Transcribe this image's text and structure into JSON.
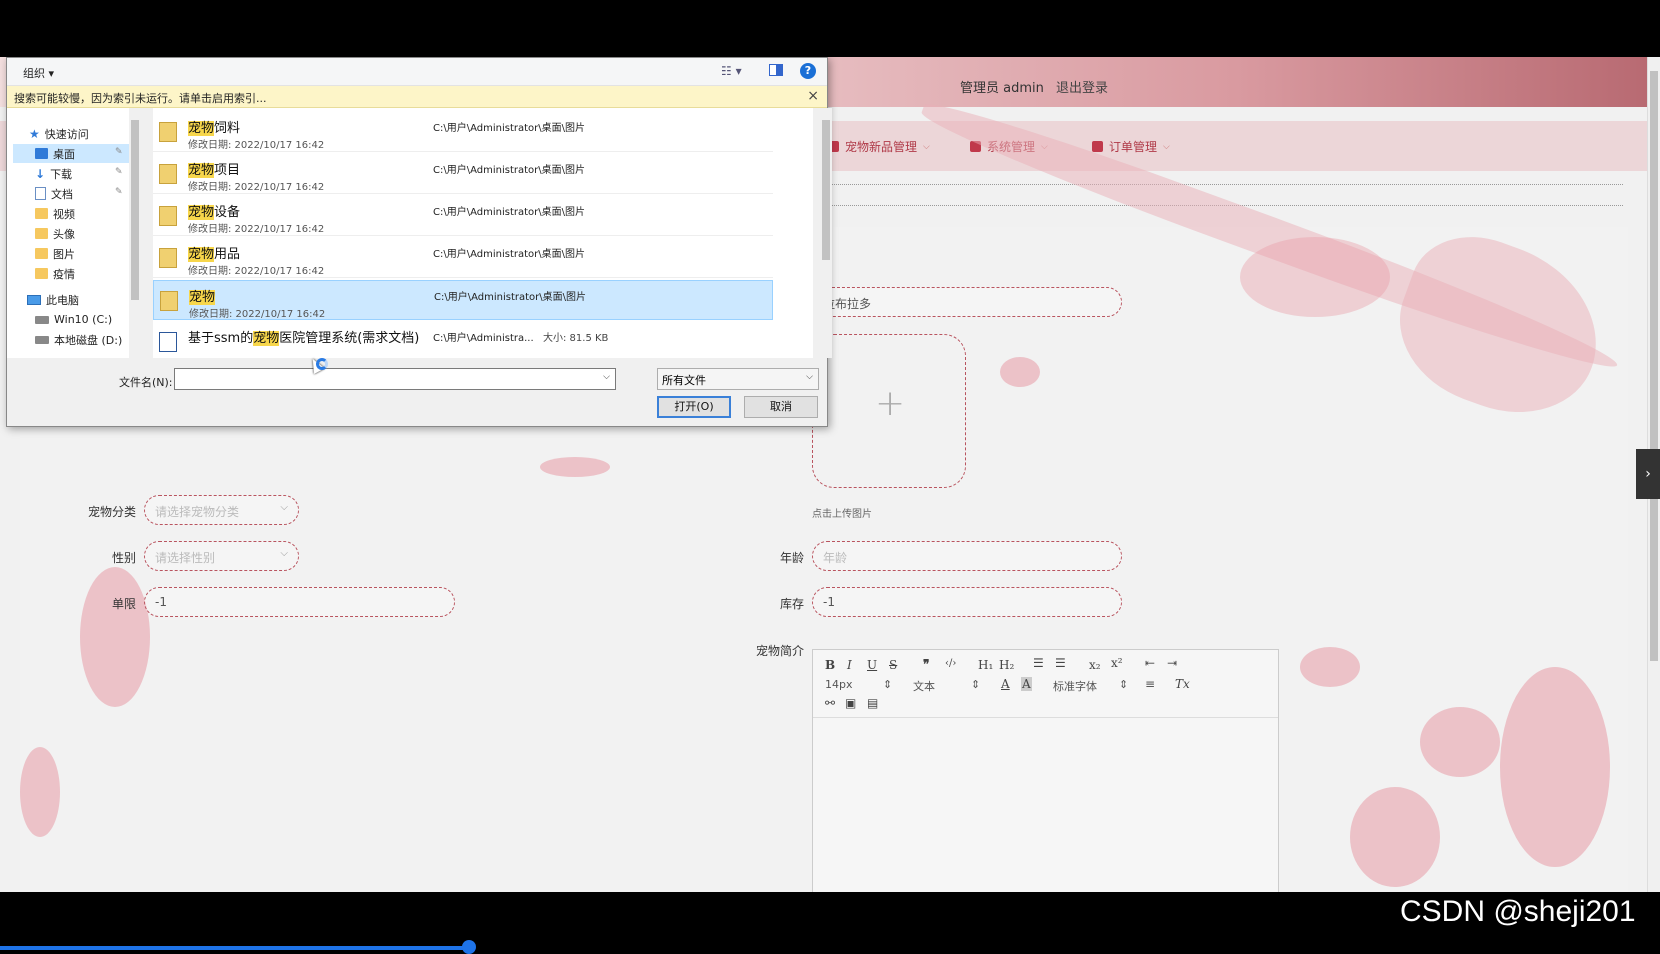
{
  "web": {
    "admin_label": "管理员 admin",
    "logout_label": "退出登录",
    "nav": [
      {
        "label": "宠物新品管理"
      },
      {
        "label": "系统管理"
      },
      {
        "label": "订单管理"
      }
    ],
    "form": {
      "name_value": "拉布拉多",
      "upload_hint": "点击上传图片",
      "category_label": "宠物分类",
      "category_placeholder": "请选择宠物分类",
      "gender_label": "性别",
      "gender_placeholder": "请选择性别",
      "limit_label": "单限",
      "limit_value": "-1",
      "age_label": "年龄",
      "age_placeholder": "年龄",
      "stock_label": "库存",
      "stock_value": "-1",
      "intro_label": "宠物简介"
    },
    "editor": {
      "font_size": "14px",
      "paragraph": "文本",
      "font_family": "标准字体"
    }
  },
  "dialog": {
    "organize_label": "组织 ▾",
    "index_notice": "搜索可能较慢，因为索引未运行。请单击启用索引...",
    "nav_tree": [
      {
        "label": "快速访问"
      },
      {
        "label": "桌面"
      },
      {
        "label": "下载"
      },
      {
        "label": "文档"
      },
      {
        "label": "视频"
      },
      {
        "label": "头像"
      },
      {
        "label": "图片"
      },
      {
        "label": "疫情"
      },
      {
        "label": "此电脑"
      },
      {
        "label": "Win10 (C:)"
      },
      {
        "label": "本地磁盘 (D:)"
      }
    ],
    "files": [
      {
        "hl": "宠物",
        "rest": "饲料",
        "date": "修改日期: 2022/10/17 16:42",
        "path": "C:\\用户\\Administrator\\桌面\\图片"
      },
      {
        "hl": "宠物",
        "rest": "项目",
        "date": "修改日期: 2022/10/17 16:42",
        "path": "C:\\用户\\Administrator\\桌面\\图片"
      },
      {
        "hl": "宠物",
        "rest": "设备",
        "date": "修改日期: 2022/10/17 16:42",
        "path": "C:\\用户\\Administrator\\桌面\\图片"
      },
      {
        "hl": "宠物",
        "rest": "用品",
        "date": "修改日期: 2022/10/17 16:42",
        "path": "C:\\用户\\Administrator\\桌面\\图片"
      },
      {
        "hl": "宠物",
        "rest": "",
        "date": "修改日期: 2022/10/17 16:42",
        "path": "C:\\用户\\Administrator\\桌面\\图片"
      }
    ],
    "doc_file": {
      "pre": "基于ssm的",
      "hl": "宠物",
      "post": "医院管理系统(需求文档)",
      "path": "C:\\用户\\Administra...",
      "size": "大小: 81.5 KB"
    },
    "filename_label": "文件名(N):",
    "filename_value": "",
    "filetype_value": "所有文件",
    "open_label": "打开(O)",
    "cancel_label": "取消"
  },
  "watermark": "CSDN @sheji201"
}
